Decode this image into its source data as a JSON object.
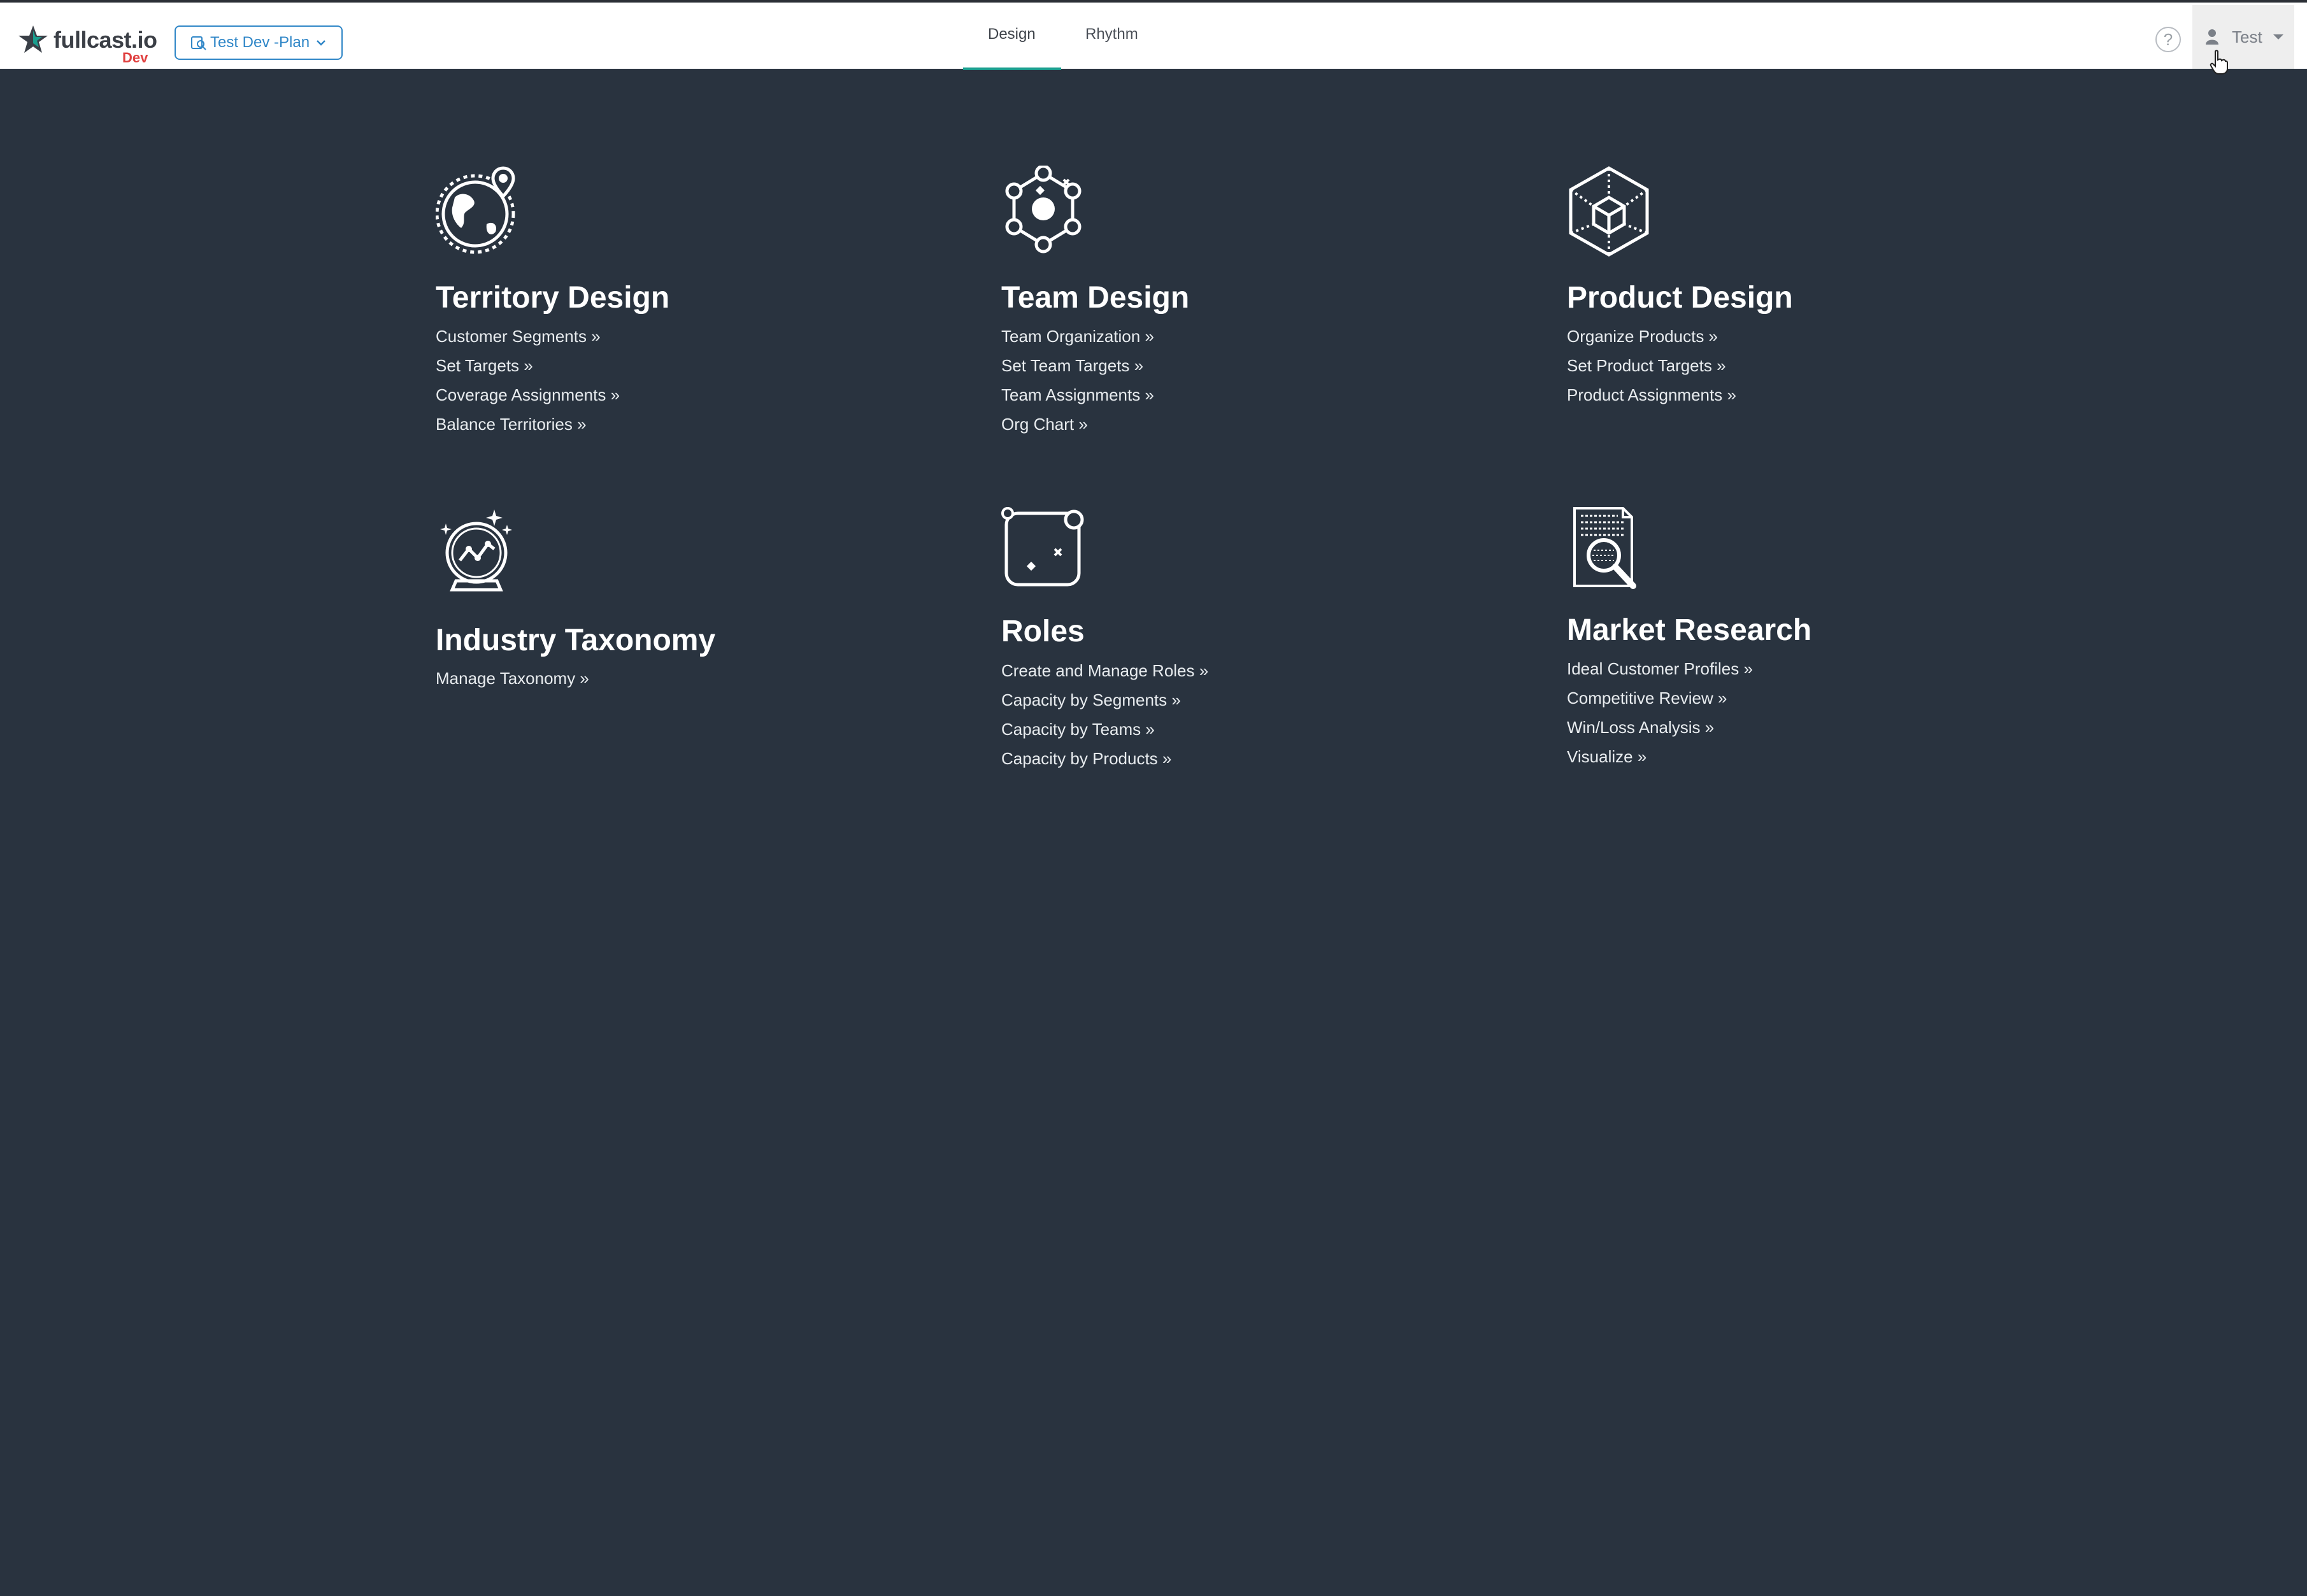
{
  "header": {
    "logo_text": "fullcast.io",
    "logo_badge": "Dev",
    "plan_selector": "Test Dev -Plan",
    "tabs": [
      {
        "label": "Design",
        "active": true
      },
      {
        "label": "Rhythm",
        "active": false
      }
    ],
    "help_label": "?",
    "user_name": "Test"
  },
  "colors": {
    "background": "#29333f",
    "accent": "#1a9e8e",
    "link_blue": "#2f86c7",
    "logo_red": "#e04040"
  },
  "sections": [
    {
      "title": "Territory Design",
      "icon": "globe-pin-icon",
      "links": [
        "Customer Segments »",
        "Set Targets »",
        "Coverage Assignments »",
        "Balance Territories »"
      ]
    },
    {
      "title": "Team Design",
      "icon": "network-hub-icon",
      "links": [
        "Team Organization »",
        "Set Team Targets »",
        "Team Assignments »",
        "Org Chart »"
      ]
    },
    {
      "title": "Product Design",
      "icon": "cube-icon",
      "links": [
        "Organize Products »",
        "Set Product Targets »",
        "Product Assignments »"
      ]
    },
    {
      "title": "Industry Taxonomy",
      "icon": "crystal-ball-icon",
      "links": [
        "Manage Taxonomy »"
      ]
    },
    {
      "title": "Roles",
      "icon": "roles-board-icon",
      "links": [
        "Create and Manage Roles »",
        "Capacity by Segments »",
        "Capacity by Teams »",
        "Capacity by Products »"
      ]
    },
    {
      "title": "Market Research",
      "icon": "document-search-icon",
      "links": [
        "Ideal Customer Profiles »",
        "Competitive Review »",
        "Win/Loss Analysis »",
        "Visualize »"
      ]
    }
  ]
}
